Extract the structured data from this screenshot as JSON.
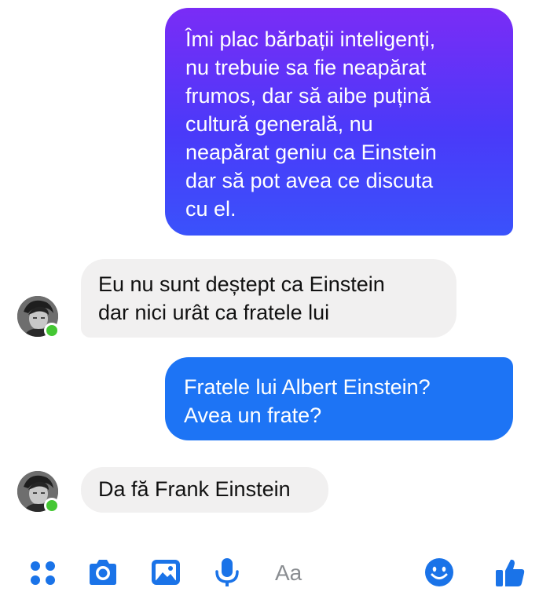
{
  "messages": [
    {
      "direction": "outgoing",
      "text": "Îmi plac bărbații inteligenți,\nnu trebuie sa fie neapărat\nfrumos, dar să aibe puțină\ncultură generală, nu\nneapărat geniu  ca Einstein\ndar să pot avea ce discuta\ncu el."
    },
    {
      "direction": "incoming",
      "text": "Eu nu sunt deștept ca Einstein\ndar nici urât ca fratele lui"
    },
    {
      "direction": "outgoing",
      "text": "Fratele lui Albert Einstein?\nAvea un frate?"
    },
    {
      "direction": "incoming",
      "text": "Da fă Frank Einstein"
    }
  ],
  "contact": {
    "avatar": "avatar-photo",
    "status": "online"
  },
  "composer": {
    "placeholder": "Aa",
    "icons": [
      "apps-grid-icon",
      "camera-icon",
      "gallery-icon",
      "microphone-icon",
      "emoji-icon",
      "thumbs-up-icon"
    ]
  },
  "colors": {
    "outgoing_gradient_top": "#7a2cf6",
    "outgoing_gradient_bottom": "#3a52fb",
    "outgoing_blue": "#1d74f5",
    "incoming_bubble": "#f1f0f0",
    "online_dot": "#44c733",
    "toolbar_icon": "#1a73e8"
  }
}
